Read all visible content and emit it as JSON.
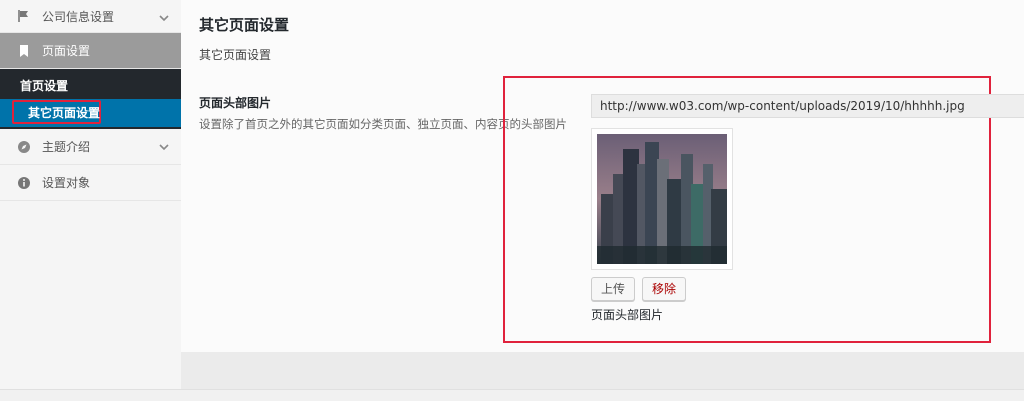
{
  "sidebar": {
    "items": [
      {
        "label": "公司信息设置",
        "icon": "flag-icon",
        "has_chevron": true
      },
      {
        "label": "页面设置",
        "icon": "bookmark-icon",
        "active": true
      },
      {
        "label": "主题介绍",
        "icon": "compass-icon",
        "has_chevron": true
      },
      {
        "label": "设置对象",
        "icon": "info-icon"
      }
    ],
    "submenu": [
      {
        "label": "首页设置"
      },
      {
        "label": "其它页面设置",
        "current": true
      }
    ]
  },
  "main": {
    "title": "其它页面设置",
    "description": "其它页面设置",
    "field": {
      "label": "页面头部图片",
      "description": "设置除了首页之外的其它页面如分类页面、独立页面、内容页的头部图片",
      "url_value": "http://www.w03.com/wp-content/uploads/2019/10/hhhhh.jpg",
      "upload_button": "上传",
      "remove_button": "移除",
      "image_caption": "页面头部图片"
    }
  },
  "colors": {
    "accent_blue": "#0073aa",
    "highlight_red": "#e0223c",
    "menu_dark": "#23282d",
    "remove_red": "#a00"
  }
}
